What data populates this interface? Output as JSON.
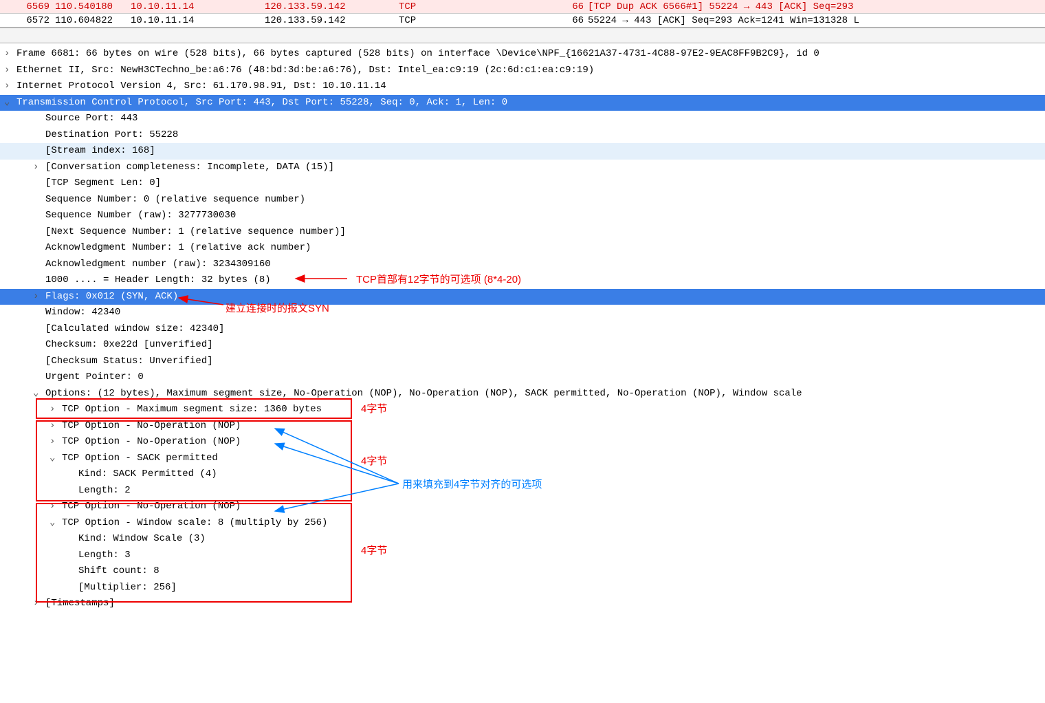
{
  "packets": [
    {
      "no": "6569",
      "time": "110.540180",
      "src": "10.10.11.14",
      "dst": "120.133.59.142",
      "proto": "TCP",
      "len": "66",
      "info": "[TCP Dup ACK 6566#1] 55224 → 443 [ACK] Seq=293",
      "cls": "red"
    },
    {
      "no": "6572",
      "time": "110.604822",
      "src": "10.10.11.14",
      "dst": "120.133.59.142",
      "proto": "TCP",
      "len": "66",
      "info": "55224 → 443 [ACK] Seq=293 Ack=1241 Win=131328 L",
      "cls": "white"
    }
  ],
  "tree": {
    "frame": "Frame 6681: 66 bytes on wire (528 bits), 66 bytes captured (528 bits) on interface \\Device\\NPF_{16621A37-4731-4C88-97E2-9EAC8FF9B2C9}, id 0",
    "eth": "Ethernet II, Src: NewH3CTechno_be:a6:76 (48:bd:3d:be:a6:76), Dst: Intel_ea:c9:19 (2c:6d:c1:ea:c9:19)",
    "ip": "Internet Protocol Version 4, Src: 61.170.98.91, Dst: 10.10.11.14",
    "tcp": "Transmission Control Protocol, Src Port: 443, Dst Port: 55228, Seq: 0, Ack: 1, Len: 0",
    "srcport": "Source Port: 443",
    "dstport": "Destination Port: 55228",
    "stream": "[Stream index: 168]",
    "conv": "[Conversation completeness: Incomplete, DATA (15)]",
    "seglen": "[TCP Segment Len: 0]",
    "seqnum": "Sequence Number: 0    (relative sequence number)",
    "seqraw": "Sequence Number (raw): 3277730030",
    "nextseq": "[Next Sequence Number: 1    (relative sequence number)]",
    "acknum": "Acknowledgment Number: 1    (relative ack number)",
    "ackraw": "Acknowledgment number (raw): 3234309160",
    "hdrlen": "1000 .... = Header Length: 32 bytes (8)",
    "flags": "Flags: 0x012 (SYN, ACK)",
    "window": "Window: 42340",
    "calcwin": "[Calculated window size: 42340]",
    "checksum": "Checksum: 0xe22d [unverified]",
    "chkstat": "[Checksum Status: Unverified]",
    "urgent": "Urgent Pointer: 0",
    "options": "Options: (12 bytes), Maximum segment size, No-Operation (NOP), No-Operation (NOP), SACK permitted, No-Operation (NOP), Window scale",
    "opt_mss": "TCP Option - Maximum segment size: 1360 bytes",
    "opt_nop1": "TCP Option - No-Operation (NOP)",
    "opt_nop2": "TCP Option - No-Operation (NOP)",
    "opt_sack": "TCP Option - SACK permitted",
    "opt_sack_kind": "Kind: SACK Permitted (4)",
    "opt_sack_len": "Length: 2",
    "opt_nop3": "TCP Option - No-Operation (NOP)",
    "opt_ws": "TCP Option - Window scale: 8 (multiply by 256)",
    "opt_ws_kind": "Kind: Window Scale (3)",
    "opt_ws_len": "Length: 3",
    "opt_ws_shift": "Shift count: 8",
    "opt_ws_mult": "[Multiplier: 256]",
    "opt_ts": "[Timestamps]"
  },
  "annotations": {
    "a1": "TCP首部有12字节的可选项 (8*4-20)",
    "a2": "建立连接时的报文SYN",
    "a3": "4字节",
    "a4": "4字节",
    "a5": "用来填充到4字节对齐的可选项",
    "a6": "4字节"
  }
}
